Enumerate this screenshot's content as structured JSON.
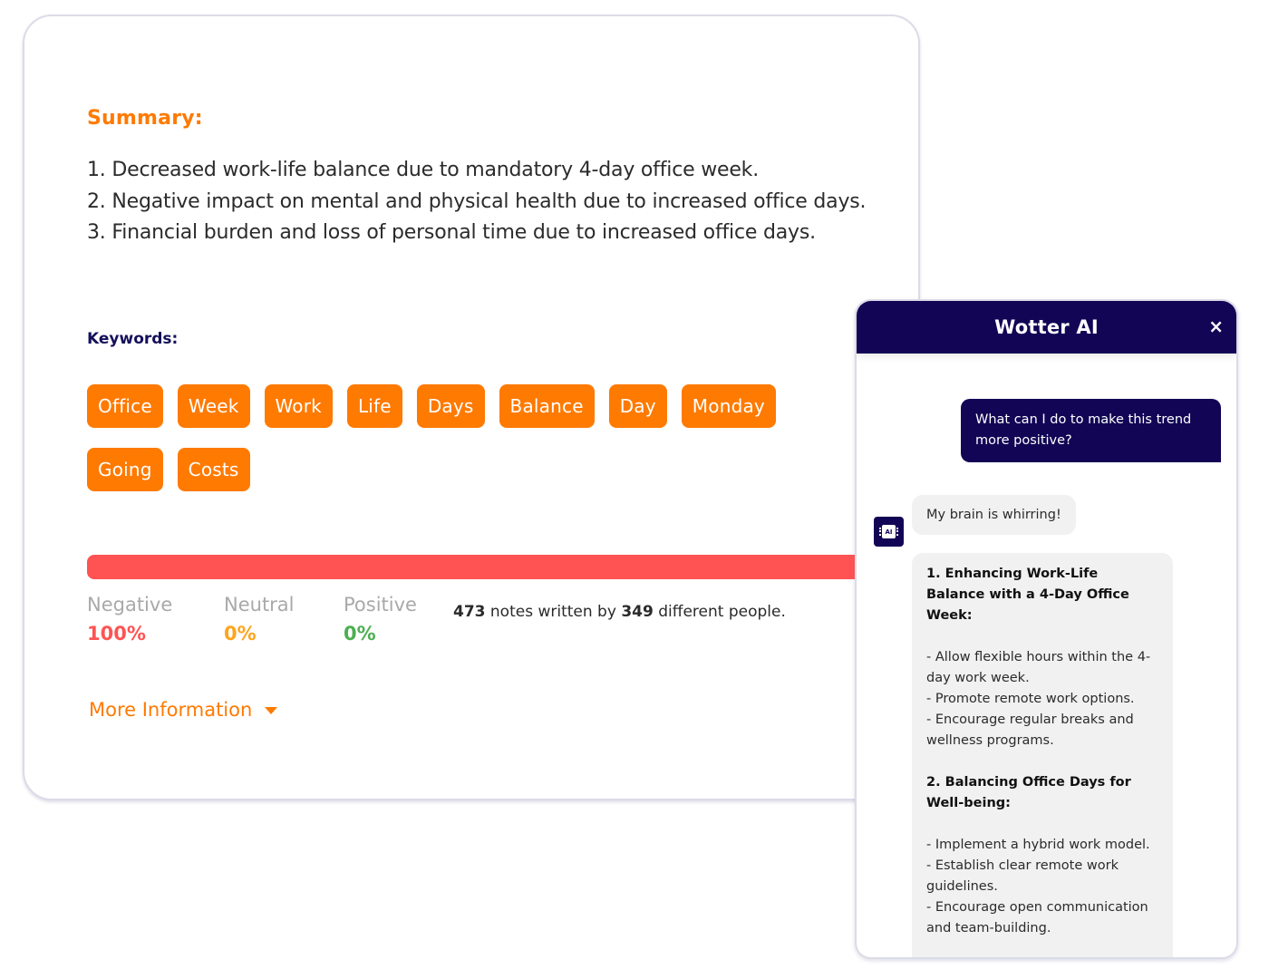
{
  "summary": {
    "title": "Summary:",
    "items": [
      "1. Decreased work-life balance due to mandatory 4-day office week.",
      "2. Negative impact on mental and physical health due to increased office days.",
      "3. Financial burden and loss of personal time due to increased office days."
    ]
  },
  "keywords": {
    "title": "Keywords:",
    "items": [
      "Office",
      "Week",
      "Work",
      "Life",
      "Days",
      "Balance",
      "Day",
      "Monday",
      "Going",
      "Costs"
    ]
  },
  "sentiment": {
    "negative": {
      "label": "Negative",
      "value": "100%",
      "color": "#ff5353",
      "fraction": 1.0
    },
    "neutral": {
      "label": "Neutral",
      "value": "0%",
      "color": "#ffa41b",
      "fraction": 0.0
    },
    "positive": {
      "label": "Positive",
      "value": "0%",
      "color": "#4caf50",
      "fraction": 0.0
    },
    "notes_count": "473",
    "notes_text_1": "notes written by",
    "people_count": "349",
    "notes_text_2": "different people."
  },
  "more_info": {
    "label": "More Information",
    "icon": "caret-down-icon"
  },
  "chat": {
    "title": "Wotter AI",
    "close_label": "×",
    "user_message": "What can I do to make this trend more positive?",
    "avatar_label": "AI",
    "ai_status": "My brain is whirring!",
    "ai_response": {
      "section1_heading": "1. Enhancing Work-Life Balance with a 4-Day Office Week:",
      "section1_items": [
        "- Allow flexible hours within the 4-day work week.",
        "- Promote remote work options.",
        "- Encourage regular breaks and wellness programs."
      ],
      "section2_heading": "2. Balancing Office Days for Well-being:",
      "section2_items": [
        "- Implement a hybrid work model.",
        "- Establish clear remote work guidelines.",
        "- Encourage open communication and team-building."
      ]
    }
  },
  "colors": {
    "accent": "#ff7a00",
    "navy": "#120555",
    "negative": "#ff5353"
  }
}
